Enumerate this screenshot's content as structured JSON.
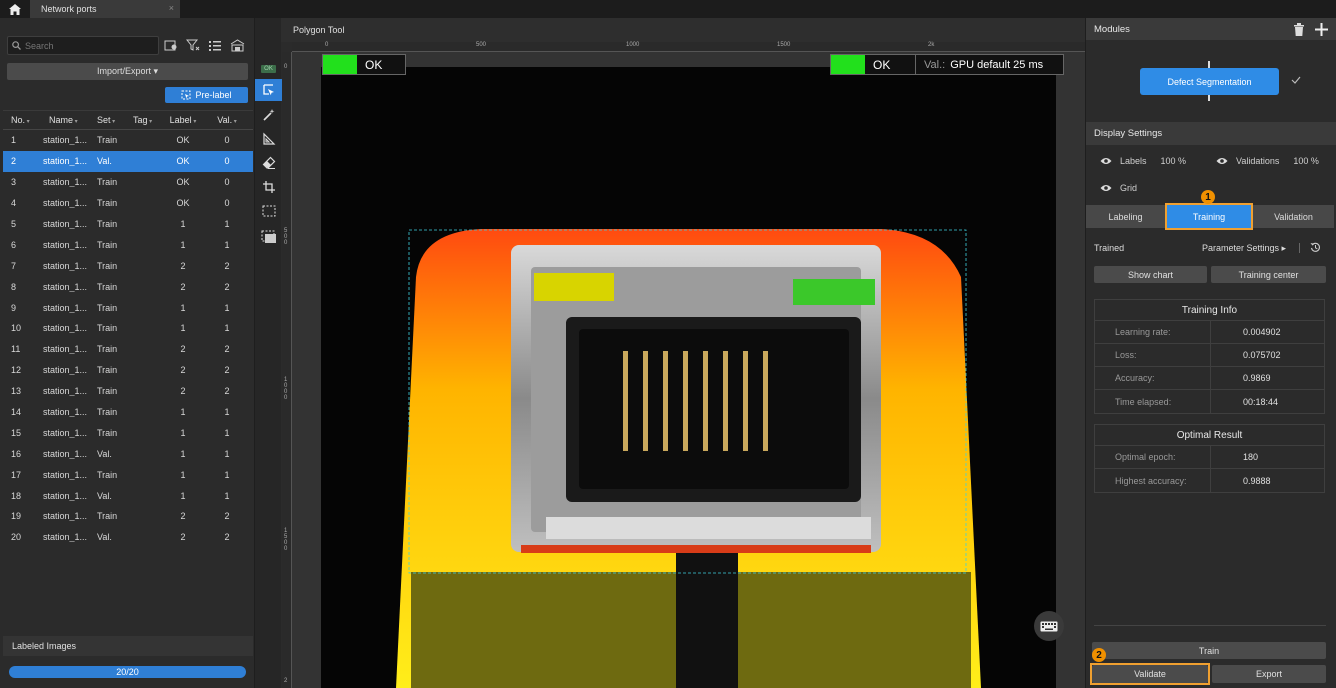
{
  "tab": {
    "title": "Network ports",
    "close": "×"
  },
  "left": {
    "search_placeholder": "Search",
    "import_export": "Import/Export ▾",
    "pre_label": "Pre-label",
    "columns": [
      "No.",
      "Name",
      "Set",
      "Tag",
      "Label",
      "Val."
    ],
    "rows": [
      {
        "no": "1",
        "name": "station_1...",
        "set": "Train",
        "tag": "",
        "label": "OK",
        "val": "0"
      },
      {
        "no": "2",
        "name": "station_1...",
        "set": "Val.",
        "tag": "",
        "label": "OK",
        "val": "0"
      },
      {
        "no": "3",
        "name": "station_1...",
        "set": "Train",
        "tag": "",
        "label": "OK",
        "val": "0"
      },
      {
        "no": "4",
        "name": "station_1...",
        "set": "Train",
        "tag": "",
        "label": "OK",
        "val": "0"
      },
      {
        "no": "5",
        "name": "station_1...",
        "set": "Train",
        "tag": "",
        "label": "1",
        "val": "1"
      },
      {
        "no": "6",
        "name": "station_1...",
        "set": "Train",
        "tag": "",
        "label": "1",
        "val": "1"
      },
      {
        "no": "7",
        "name": "station_1...",
        "set": "Train",
        "tag": "",
        "label": "2",
        "val": "2"
      },
      {
        "no": "8",
        "name": "station_1...",
        "set": "Train",
        "tag": "",
        "label": "2",
        "val": "2"
      },
      {
        "no": "9",
        "name": "station_1...",
        "set": "Train",
        "tag": "",
        "label": "1",
        "val": "1"
      },
      {
        "no": "10",
        "name": "station_1...",
        "set": "Train",
        "tag": "",
        "label": "1",
        "val": "1"
      },
      {
        "no": "11",
        "name": "station_1...",
        "set": "Train",
        "tag": "",
        "label": "2",
        "val": "2"
      },
      {
        "no": "12",
        "name": "station_1...",
        "set": "Train",
        "tag": "",
        "label": "2",
        "val": "2"
      },
      {
        "no": "13",
        "name": "station_1...",
        "set": "Train",
        "tag": "",
        "label": "2",
        "val": "2"
      },
      {
        "no": "14",
        "name": "station_1...",
        "set": "Train",
        "tag": "",
        "label": "1",
        "val": "1"
      },
      {
        "no": "15",
        "name": "station_1...",
        "set": "Train",
        "tag": "",
        "label": "1",
        "val": "1"
      },
      {
        "no": "16",
        "name": "station_1...",
        "set": "Val.",
        "tag": "",
        "label": "1",
        "val": "1"
      },
      {
        "no": "17",
        "name": "station_1...",
        "set": "Train",
        "tag": "",
        "label": "1",
        "val": "1"
      },
      {
        "no": "18",
        "name": "station_1...",
        "set": "Val.",
        "tag": "",
        "label": "1",
        "val": "1"
      },
      {
        "no": "19",
        "name": "station_1...",
        "set": "Train",
        "tag": "",
        "label": "2",
        "val": "2"
      },
      {
        "no": "20",
        "name": "station_1...",
        "set": "Val.",
        "tag": "",
        "label": "2",
        "val": "2"
      }
    ],
    "selected_row": 2,
    "labeled_images_title": "Labeled Images",
    "labeled_progress": "20/20",
    "labeled_fraction": 1.0
  },
  "toolbar": {
    "ok_badge": "OK"
  },
  "canvas": {
    "title": "Polygon Tool",
    "ruler_top": [
      "0",
      "500",
      "1000",
      "1500",
      "2k"
    ],
    "ruler_left": [
      "0",
      "5\n0\n0",
      "1\n0\n0\n0",
      "1\n5\n0\n0",
      "2"
    ],
    "ok_left": "OK",
    "ok_right": "OK",
    "val_prefix": "Val.:",
    "val_text": "GPU default 25 ms"
  },
  "right": {
    "modules_title": "Modules",
    "module_name": "Defect Segmentation",
    "display_settings_title": "Display Settings",
    "labels_text": "Labels",
    "labels_pct": "100 %",
    "validations_text": "Validations",
    "validations_pct": "100 %",
    "grid_text": "Grid",
    "tabs": [
      "Labeling",
      "Training",
      "Validation"
    ],
    "status": "Trained",
    "param_settings": "Parameter Settings ▸",
    "show_chart": "Show chart",
    "training_center": "Training center",
    "training_info": {
      "title": "Training Info",
      "rows": [
        {
          "k": "Learning rate:",
          "v": "0.004902"
        },
        {
          "k": "Loss:",
          "v": "0.075702"
        },
        {
          "k": "Accuracy:",
          "v": "0.9869"
        },
        {
          "k": "Time elapsed:",
          "v": "00:18:44"
        }
      ]
    },
    "optimal": {
      "title": "Optimal Result",
      "rows": [
        {
          "k": "Optimal epoch:",
          "v": "180"
        },
        {
          "k": "Highest accuracy:",
          "v": "0.9888"
        }
      ]
    },
    "train_btn": "Train",
    "validate_btn": "Validate",
    "export_btn": "Export",
    "marker1": "1",
    "marker2": "2"
  },
  "colors": {
    "accent": "#2f7fd6",
    "ok_green": "#22e01c",
    "highlight": "#f0a030"
  }
}
